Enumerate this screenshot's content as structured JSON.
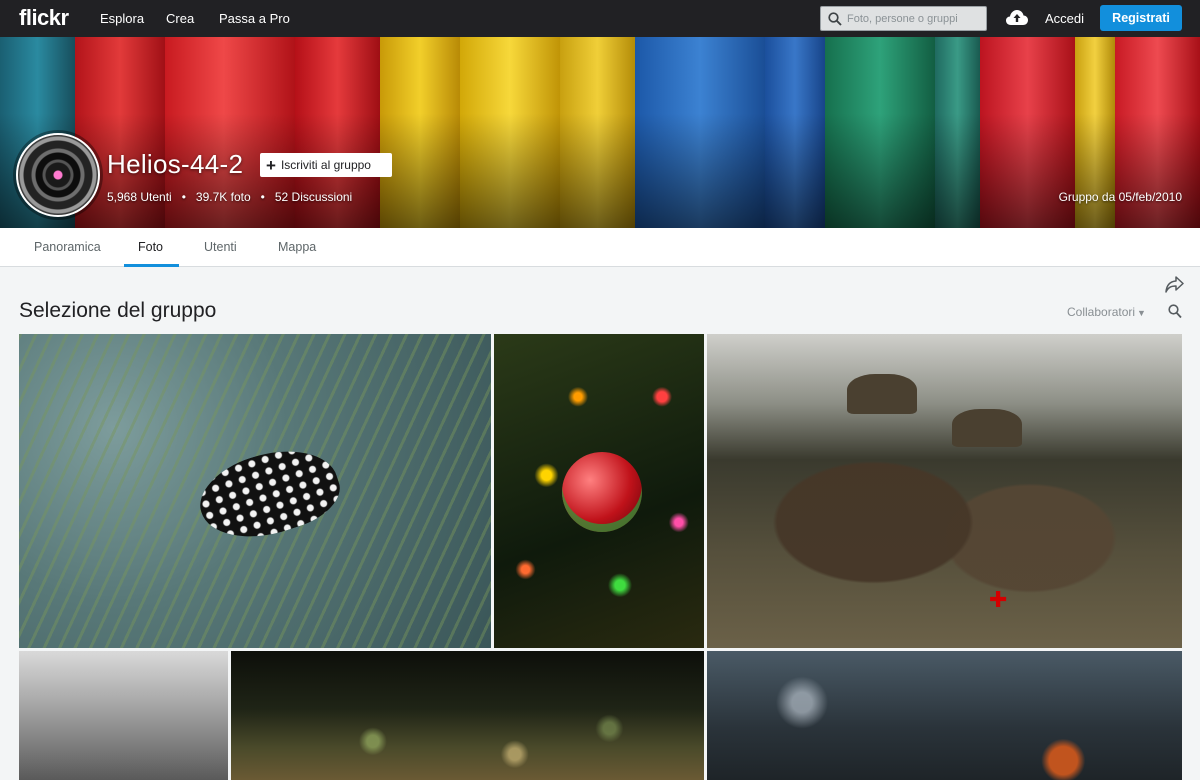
{
  "nav": {
    "logo": "flickr",
    "links": [
      "Esplora",
      "Crea",
      "Passa a Pro"
    ],
    "search_placeholder": "Foto, persone o gruppi",
    "login": "Accedi",
    "register": "Registrati"
  },
  "group": {
    "title": "Helios-44-2",
    "join_label": "Iscriviti al gruppo",
    "members": "5,968 Utenti",
    "photos": "39.7K foto",
    "discussions": "52 Discussioni",
    "since": "Gruppo da 05/feb/2010"
  },
  "tabs": [
    {
      "label": "Panoramica",
      "active": false
    },
    {
      "label": "Foto",
      "active": true
    },
    {
      "label": "Utenti",
      "active": false
    },
    {
      "label": "Mappa",
      "active": false
    }
  ],
  "section": {
    "title": "Selezione del gruppo",
    "filter_label": "Collaboratori"
  },
  "photos": [
    {
      "subject": "feather-on-pine-branch"
    },
    {
      "subject": "christmas-ornament-lights"
    },
    {
      "subject": "soldiers-in-field"
    },
    {
      "subject": "black-white-fence"
    },
    {
      "subject": "bokeh-grass"
    },
    {
      "subject": "leaves-on-branch"
    }
  ],
  "colors": {
    "nav_bg": "#212124",
    "accent": "#128fdc",
    "page_bg": "#f3f5f6"
  }
}
